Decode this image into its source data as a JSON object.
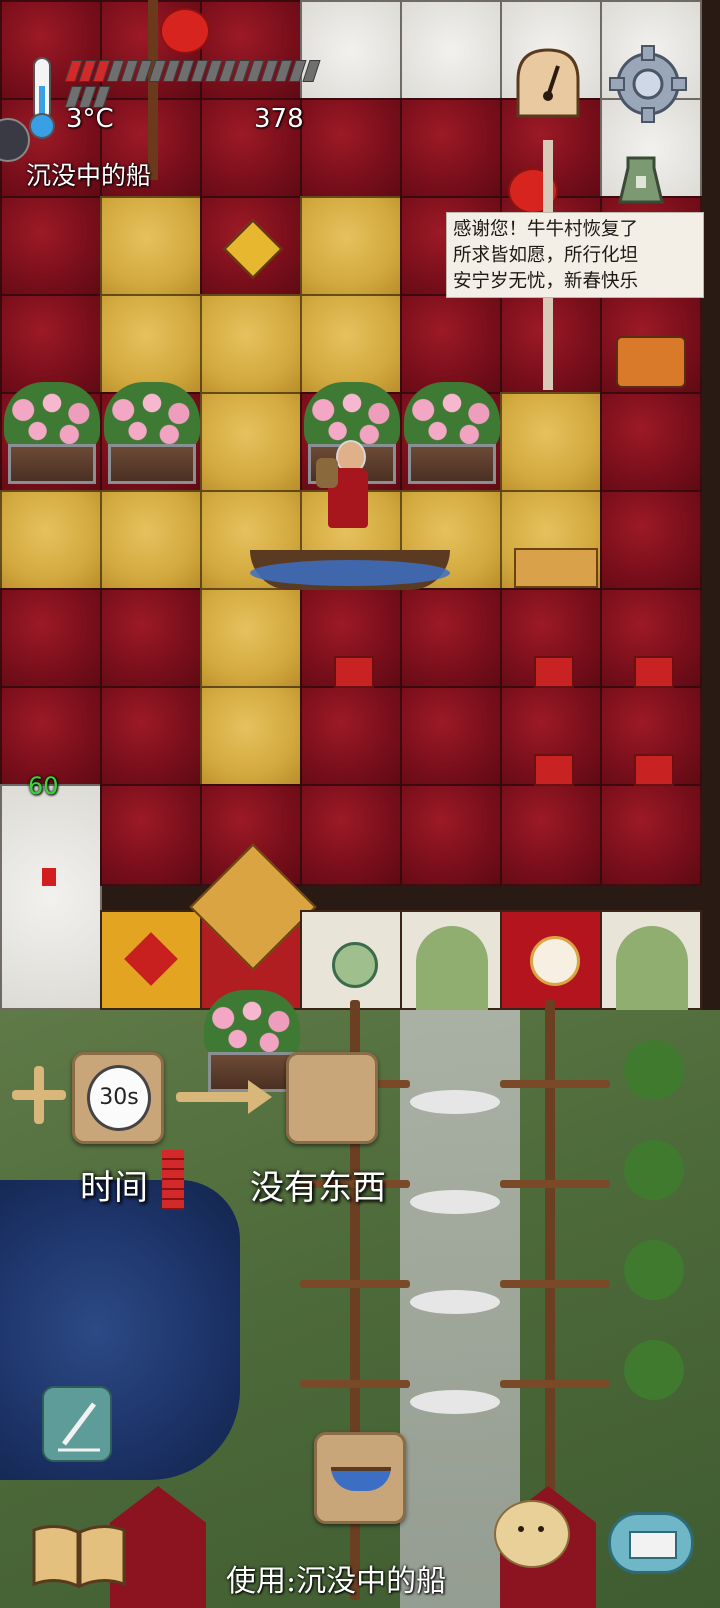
{
  "hud": {
    "temperature": "3°C",
    "score": "378",
    "held_item": "沉没中的船",
    "fps": "60",
    "temperature_fill": 0.16
  },
  "sign": {
    "lines": [
      "感谢您！牛牛村恢复了",
      "所求皆如愿，所行化坦",
      "安宁岁无忧，新春快乐"
    ]
  },
  "action": {
    "time_value": "30s",
    "time_label": "时间",
    "result_label": "没有东西",
    "use_text": "使用:沉没中的船"
  },
  "icons": {
    "thermometer": "thermometer-icon",
    "compass": "compass-icon",
    "settings": "gear-icon",
    "coin": "ancient-coin-icon",
    "note": "pencil-note-icon",
    "journal": "open-book-icon",
    "chat": "keyboard-chat-icon",
    "avatar": "potato-face-icon",
    "stopwatch": "stopwatch-icon",
    "boat": "boat-icon"
  },
  "colors": {
    "red_tile": "#7a0f1b",
    "yellow_tile": "#d2a93e",
    "temp_on": "#d22a2a",
    "fps": "#39d639"
  }
}
